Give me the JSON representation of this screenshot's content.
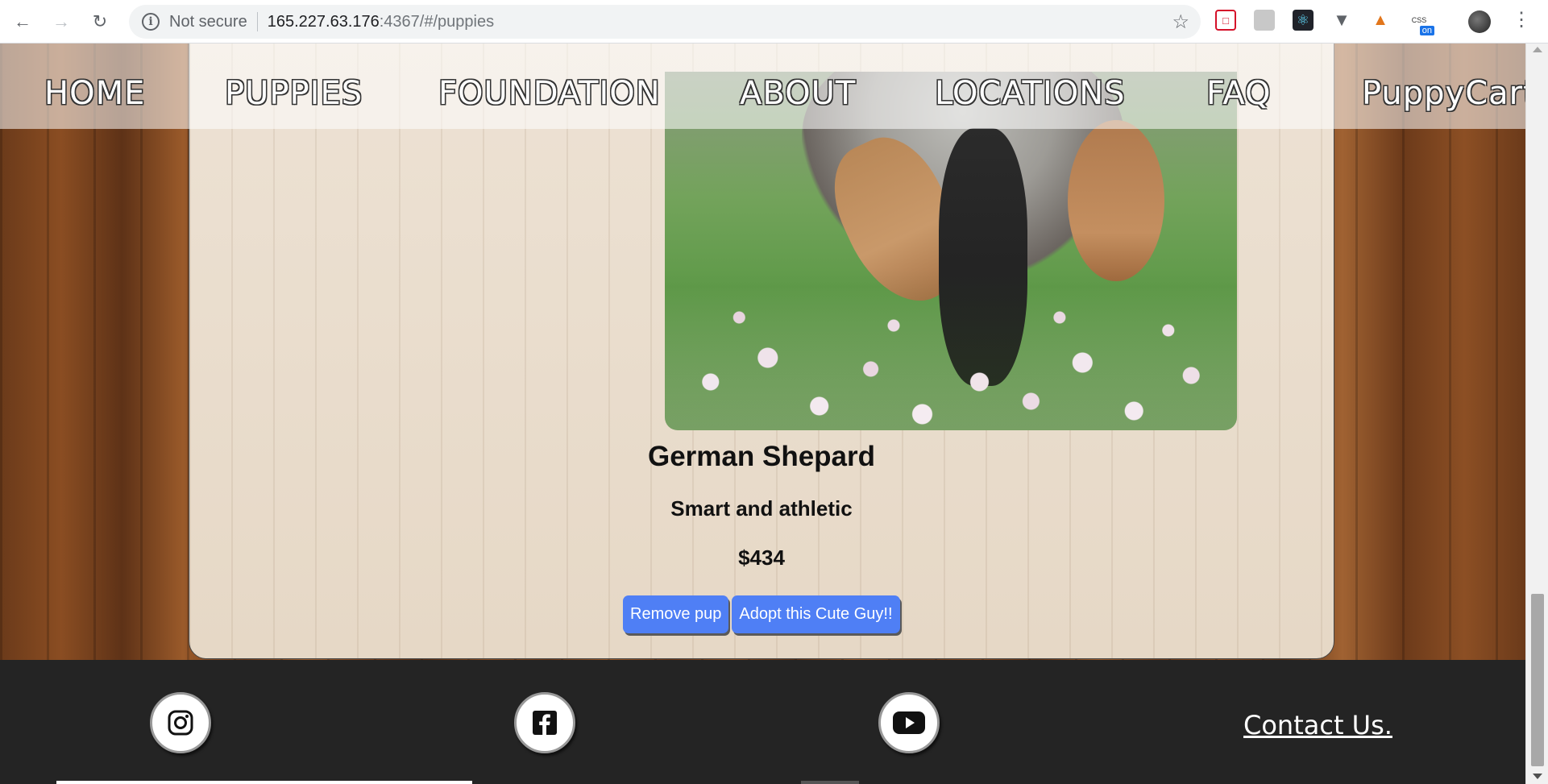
{
  "browser": {
    "security_label": "Not secure",
    "url_host": "165.227.63.176",
    "url_path": ":4367/#/puppies",
    "extension_badge": "on"
  },
  "nav": {
    "items": [
      {
        "label": "HOME"
      },
      {
        "label": "PUPPIES"
      },
      {
        "label": "FOUNDATION"
      },
      {
        "label": "ABOUT"
      },
      {
        "label": "LOCATIONS"
      },
      {
        "label": "FAQ"
      },
      {
        "label": "PuppyCart"
      }
    ]
  },
  "puppy": {
    "name": "German Shepard",
    "description": "Smart and athletic",
    "price": "$434",
    "remove_label": "Remove pup",
    "adopt_label": "Adopt this Cute Guy!!"
  },
  "footer": {
    "contact_label": "Contact Us.",
    "icons": [
      "instagram-icon",
      "facebook-icon",
      "youtube-icon"
    ]
  },
  "colors": {
    "button": "#4f7ff5",
    "footer_bg": "#242424"
  }
}
